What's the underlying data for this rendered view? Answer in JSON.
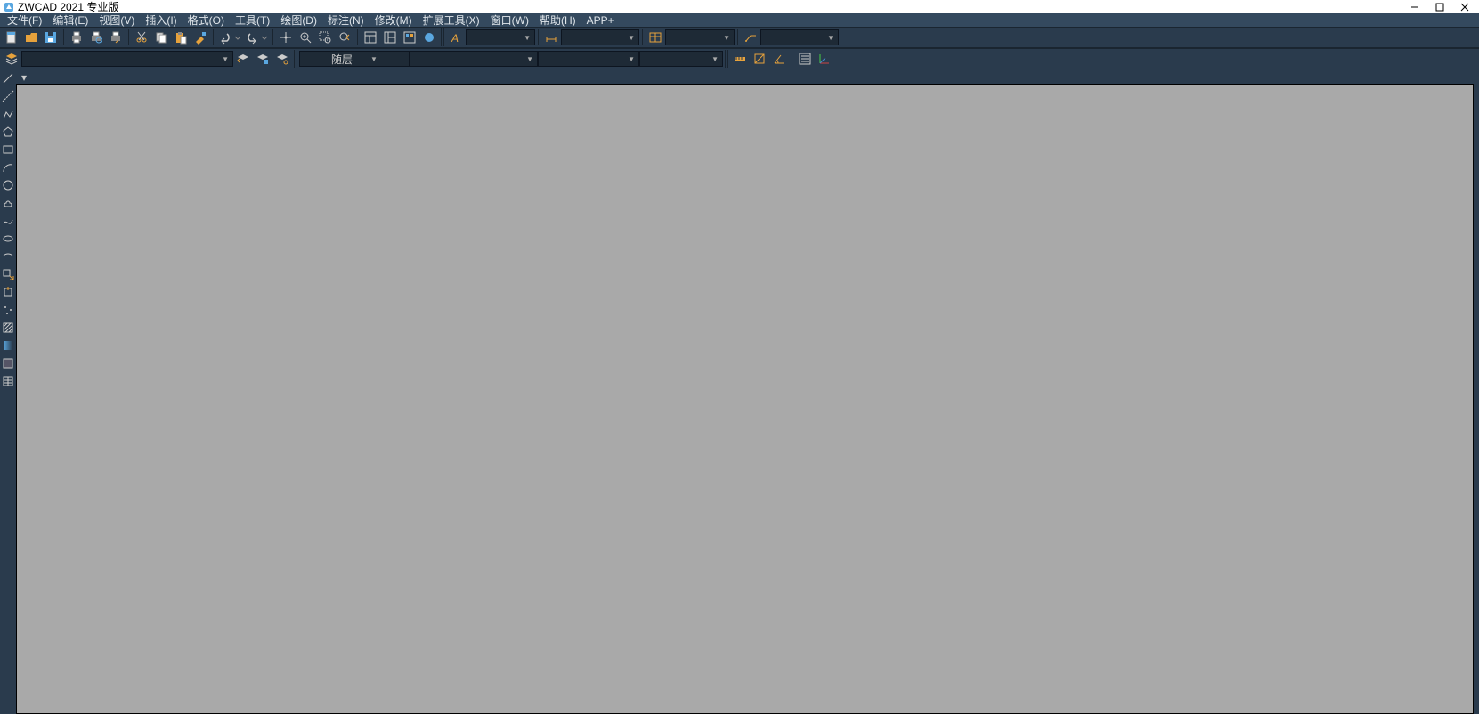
{
  "titlebar": {
    "app_title": "ZWCAD 2021 专业版"
  },
  "menu": {
    "items": [
      "文件(F)",
      "编辑(E)",
      "视图(V)",
      "插入(I)",
      "格式(O)",
      "工具(T)",
      "绘图(D)",
      "标注(N)",
      "修改(M)",
      "扩展工具(X)",
      "窗口(W)",
      "帮助(H)",
      "APP+"
    ]
  },
  "toolbar1": {
    "combo_annot": "",
    "combo_dim": "",
    "combo_table": "",
    "combo_mleader": ""
  },
  "toolbar2": {
    "layer_combo": "",
    "layer_state": "随层",
    "color": "",
    "linetype": "",
    "lineweight": ""
  },
  "icons": {
    "new": "new",
    "open": "open",
    "save": "save",
    "print": "print",
    "preview": "preview",
    "plot": "plot",
    "cut": "cut",
    "copy": "copy",
    "paste": "paste",
    "match": "match",
    "undo": "undo",
    "redo": "redo",
    "pan": "pan",
    "zoomext": "zoomext",
    "zoomwin": "zoomwin",
    "zoomprev": "zoomprev",
    "prop": "prop",
    "designc": "designc",
    "tool": "tool",
    "cloud": "cloud",
    "textstyle": "A",
    "dimstyle": "dim",
    "tablestyle": "table",
    "mleaderstyle": "mleader",
    "layerp": "layerp",
    "layeriso": "layeriso",
    "layeroff": "layeroff",
    "dist": "dist",
    "area": "area",
    "massprop": "massprop",
    "list": "list",
    "ucs": "ucs"
  }
}
